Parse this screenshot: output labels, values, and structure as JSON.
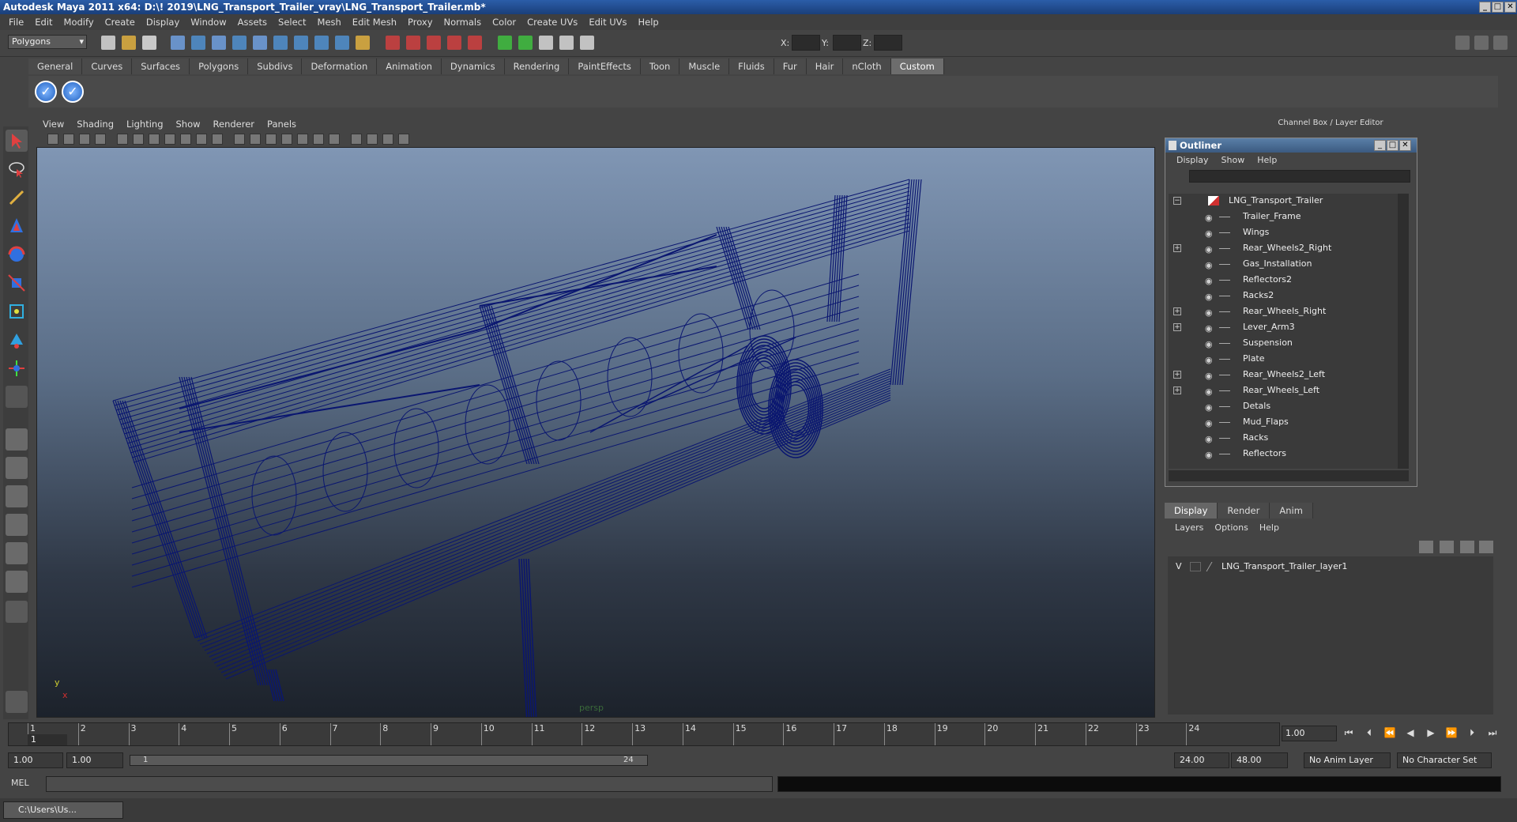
{
  "window": {
    "title": "Autodesk Maya 2011 x64: D:\\! 2019\\LNG_Transport_Trailer_vray\\LNG_Transport_Trailer.mb*"
  },
  "menu": [
    "File",
    "Edit",
    "Modify",
    "Create",
    "Display",
    "Window",
    "Assets",
    "Select",
    "Mesh",
    "Edit Mesh",
    "Proxy",
    "Normals",
    "Color",
    "Create UVs",
    "Edit UVs",
    "Help"
  ],
  "status": {
    "mode": "Polygons",
    "x_label": "X:",
    "y_label": "Y:",
    "z_label": "Z:"
  },
  "shelf_tabs": [
    "General",
    "Curves",
    "Surfaces",
    "Polygons",
    "Subdivs",
    "Deformation",
    "Animation",
    "Dynamics",
    "Rendering",
    "PaintEffects",
    "Toon",
    "Muscle",
    "Fluids",
    "Fur",
    "Hair",
    "nCloth",
    "Custom"
  ],
  "shelf_active": "Custom",
  "viewport": {
    "menu": [
      "View",
      "Shading",
      "Lighting",
      "Show",
      "Renderer",
      "Panels"
    ],
    "camera": "persp",
    "axis_y": "y",
    "axis_x": "x",
    "wire_color": "#0a1670"
  },
  "channel_box_title": "Channel Box / Layer Editor",
  "outliner": {
    "title": "Outliner",
    "menu": [
      "Display",
      "Show",
      "Help"
    ],
    "items": [
      {
        "label": "LNG_Transport_Trailer",
        "expander": "−",
        "root": true
      },
      {
        "label": "Trailer_Frame",
        "expander": ""
      },
      {
        "label": "Wings",
        "expander": ""
      },
      {
        "label": "Rear_Wheels2_Right",
        "expander": "+"
      },
      {
        "label": "Gas_Installation",
        "expander": ""
      },
      {
        "label": "Reflectors2",
        "expander": ""
      },
      {
        "label": "Racks2",
        "expander": ""
      },
      {
        "label": "Rear_Wheels_Right",
        "expander": "+"
      },
      {
        "label": "Lever_Arm3",
        "expander": "+"
      },
      {
        "label": "Suspension",
        "expander": ""
      },
      {
        "label": "Plate",
        "expander": ""
      },
      {
        "label": "Rear_Wheels2_Left",
        "expander": "+"
      },
      {
        "label": "Rear_Wheels_Left",
        "expander": "+"
      },
      {
        "label": "Detals",
        "expander": ""
      },
      {
        "label": "Mud_Flaps",
        "expander": ""
      },
      {
        "label": "Racks",
        "expander": ""
      },
      {
        "label": "Reflectors",
        "expander": ""
      }
    ]
  },
  "layer_editor": {
    "tabs": [
      "Display",
      "Render",
      "Anim"
    ],
    "active_tab": "Display",
    "menu": [
      "Layers",
      "Options",
      "Help"
    ],
    "layer": {
      "visibility": "V",
      "name": "LNG_Transport_Trailer_layer1"
    }
  },
  "timeline": {
    "ticks": [
      "1",
      "2",
      "3",
      "4",
      "5",
      "6",
      "7",
      "8",
      "9",
      "10",
      "11",
      "12",
      "13",
      "14",
      "15",
      "16",
      "17",
      "18",
      "19",
      "20",
      "21",
      "22",
      "23",
      "24"
    ],
    "current_frame": "1.00",
    "playhead": "1"
  },
  "range": {
    "start": "1.00",
    "start2": "1.00",
    "slider_start": "1",
    "slider_end": "24",
    "end": "24.00",
    "end2": "48.00",
    "anim_layer": "No Anim Layer",
    "char_set": "No Character Set"
  },
  "command": {
    "label": "MEL"
  },
  "taskbar": {
    "item": "C:\\Users\\Us..."
  }
}
